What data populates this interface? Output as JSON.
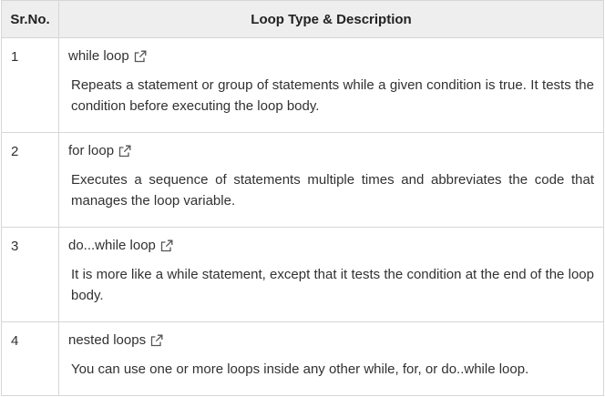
{
  "table": {
    "headers": {
      "number": "Sr.No.",
      "description": "Loop Type & Description"
    },
    "rows": [
      {
        "number": "1",
        "link": "while loop",
        "description": "Repeats a statement or group of statements while a given condition is true. It tests the condition before executing the loop body."
      },
      {
        "number": "2",
        "link": "for loop",
        "description": "Executes a sequence of statements multiple times and abbreviates the code that manages the loop variable."
      },
      {
        "number": "3",
        "link": "do...while loop",
        "description": "It is more like a while statement, except that it tests the condition at the end of the loop body."
      },
      {
        "number": "4",
        "link": "nested loops",
        "description": "You can use one or more loops inside any other while, for, or do..while loop."
      }
    ],
    "link_icon": "external-link-icon"
  }
}
